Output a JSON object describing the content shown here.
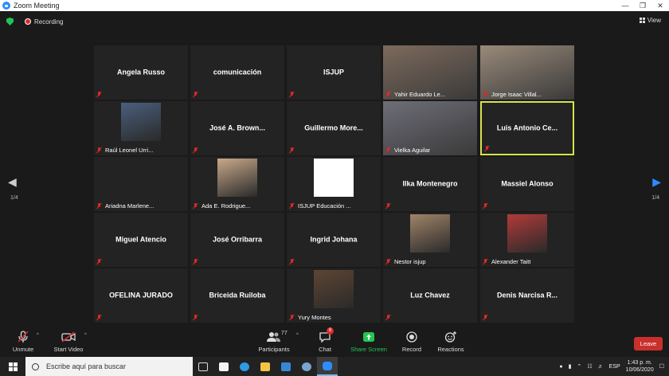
{
  "window": {
    "title": "Zoom Meeting"
  },
  "topbar": {
    "recording_label": "Recording",
    "view_label": "View"
  },
  "pager": {
    "left": "1/4",
    "right": "1/4"
  },
  "tiles": [
    {
      "name": "Angela Russo",
      "label": "",
      "mode": "big",
      "photo": ""
    },
    {
      "name": "comunicación",
      "label": "",
      "mode": "big",
      "photo": ""
    },
    {
      "name": "ISJUP",
      "label": "",
      "mode": "big",
      "photo": ""
    },
    {
      "name": "",
      "label": "Yahir Eduardo Le...",
      "mode": "video",
      "photo": "#7d6a5c"
    },
    {
      "name": "",
      "label": "Jorge Isaac Villal...",
      "mode": "video",
      "photo": "#9a8a7a"
    },
    {
      "name": "",
      "label": "Raúl Leonel Urri...",
      "mode": "photo",
      "photo": "#4a5f7d"
    },
    {
      "name": "José A. Brown...",
      "label": "",
      "mode": "big",
      "photo": ""
    },
    {
      "name": "Guillermo  More...",
      "label": "",
      "mode": "big",
      "photo": ""
    },
    {
      "name": "",
      "label": "Vielka Aguilar",
      "mode": "video",
      "photo": "#6e6e78"
    },
    {
      "name": "Luis Antonio Ce...",
      "label": "",
      "mode": "big-active",
      "photo": ""
    },
    {
      "name": "",
      "label": "Ariadna Marlene...",
      "mode": "empty",
      "photo": ""
    },
    {
      "name": "",
      "label": "Ada  E. Rodrigue...",
      "mode": "photo",
      "photo": "#c9a98a"
    },
    {
      "name": "",
      "label": "ISJUP Educación ...",
      "mode": "logo",
      "photo": "#ffffff"
    },
    {
      "name": "Ilka Montenegro",
      "label": "",
      "mode": "big",
      "photo": ""
    },
    {
      "name": "Massiel Alonso",
      "label": "",
      "mode": "big",
      "photo": ""
    },
    {
      "name": "Miguel Atencio",
      "label": "",
      "mode": "big",
      "photo": ""
    },
    {
      "name": "José Orribarra",
      "label": "",
      "mode": "big",
      "photo": ""
    },
    {
      "name": "Ingrid Johana",
      "label": "",
      "mode": "big",
      "photo": ""
    },
    {
      "name": "",
      "label": "Nestor isjup",
      "mode": "photo",
      "photo": "#a08468"
    },
    {
      "name": "",
      "label": "Alexander Taitt",
      "mode": "photo",
      "photo": "#b23a3a"
    },
    {
      "name": "OFELINA JURADO",
      "label": "",
      "mode": "big",
      "photo": ""
    },
    {
      "name": "Briceida Ruiloba",
      "label": "",
      "mode": "big",
      "photo": ""
    },
    {
      "name": "",
      "label": "Yury Montes",
      "mode": "photo",
      "photo": "#5e4533"
    },
    {
      "name": "Luz Chavez",
      "label": "",
      "mode": "big",
      "photo": ""
    },
    {
      "name": "Denis  Narcisa R...",
      "label": "",
      "mode": "big",
      "photo": ""
    }
  ],
  "toolbar": {
    "unmute": "Unmute",
    "start_video": "Start Video",
    "participants": "Participants",
    "participants_count": "77",
    "chat": "Chat",
    "chat_badge": "8",
    "share_screen": "Share Screen",
    "record": "Record",
    "reactions": "Reactions",
    "leave": "Leave"
  },
  "taskbar": {
    "search_placeholder": "Escribe aquí para buscar",
    "lang": "ESP",
    "time": "1:43 p. m.",
    "date": "10/06/2020"
  },
  "colors": {
    "share_green": "#23c552",
    "leave_red": "#c9302c",
    "active_border": "#d6e24a",
    "accent_blue": "#2d8cff"
  }
}
